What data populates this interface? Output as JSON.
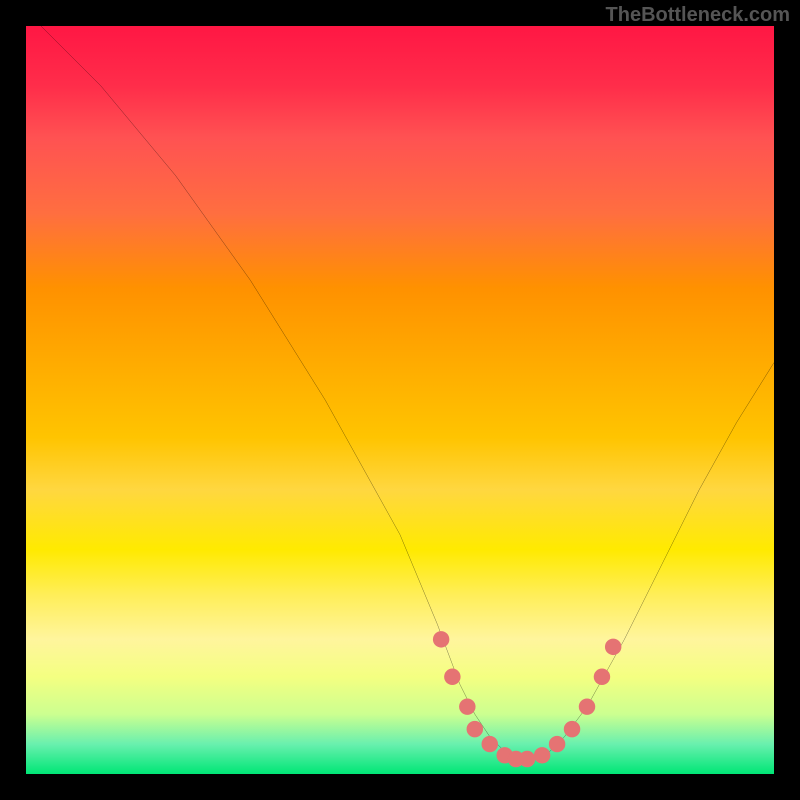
{
  "watermark": "TheBottleneck.com",
  "chart_data": {
    "type": "line",
    "title": "",
    "xlabel": "",
    "ylabel": "",
    "xlim": [
      0,
      100
    ],
    "ylim": [
      0,
      100
    ],
    "series": [
      {
        "name": "curve",
        "x": [
          2,
          10,
          20,
          30,
          40,
          50,
          55,
          58,
          60,
          62,
          64,
          66,
          68,
          70,
          72,
          75,
          80,
          85,
          90,
          95,
          100
        ],
        "y": [
          100,
          92,
          80,
          66,
          50,
          32,
          20,
          12,
          8,
          5,
          3,
          2,
          2,
          3,
          5,
          9,
          18,
          28,
          38,
          47,
          55
        ]
      }
    ],
    "markers": {
      "name": "dots",
      "x": [
        55.5,
        57,
        59,
        60,
        62,
        64,
        65.5,
        67,
        69,
        71,
        73,
        75,
        77,
        78.5
      ],
      "y": [
        18,
        13,
        9,
        6,
        4,
        2.5,
        2,
        2,
        2.5,
        4,
        6,
        9,
        13,
        17
      ]
    }
  }
}
